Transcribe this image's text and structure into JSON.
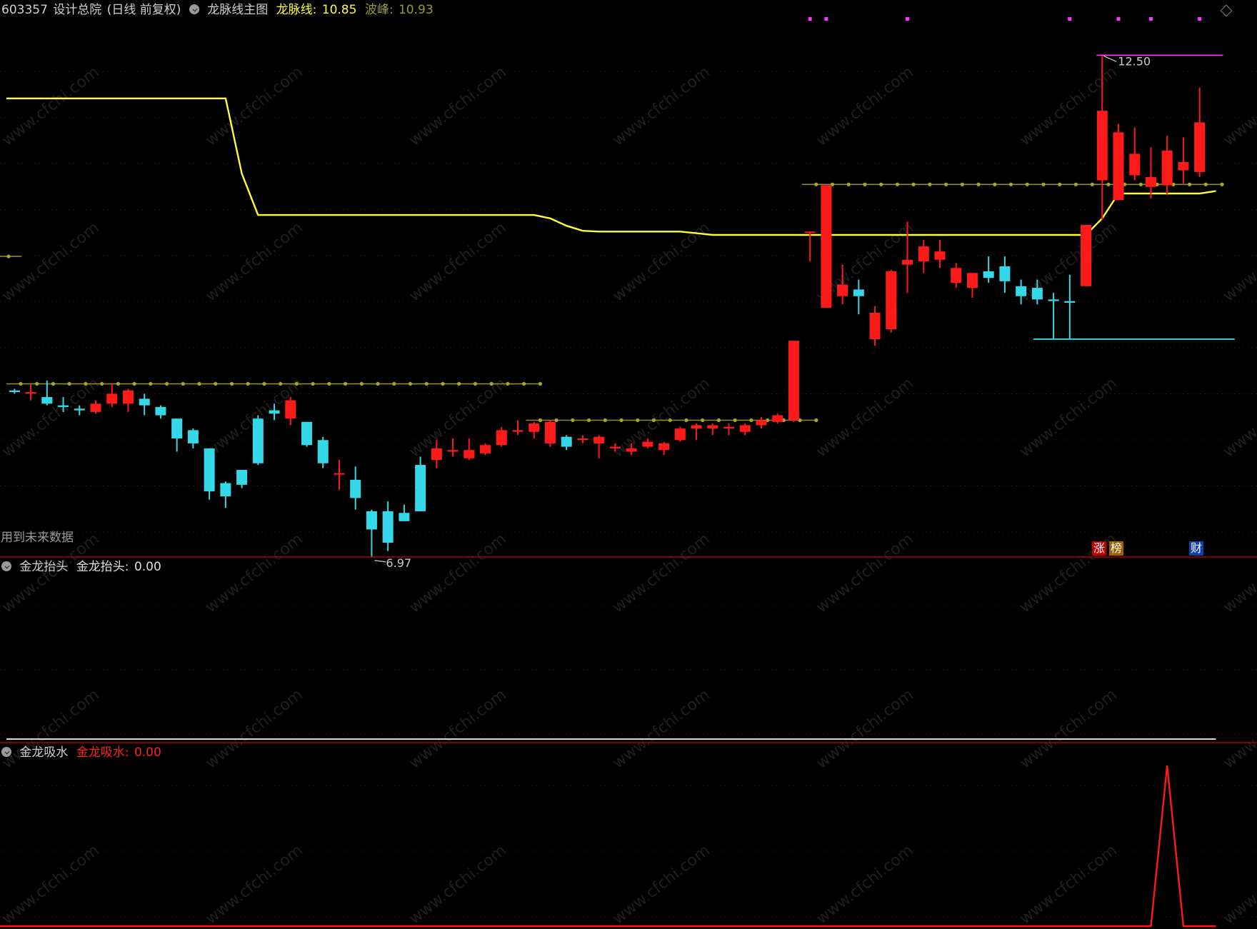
{
  "main_panel": {
    "stock_code": "603357",
    "stock_name": "设计总院",
    "period": "(日线 前复权)",
    "indicator_name": "龙脉线主图",
    "line1_label": "龙脉线:",
    "line1_value": "10.85",
    "line2_label": "波峰:",
    "line2_value": "10.93",
    "high_marker": "12.50",
    "low_marker": "6.97",
    "future_data_note": "用到未来数据",
    "badge_zhang": "涨",
    "badge_bang": "榜",
    "badge_cai": "财"
  },
  "sub_panel_1": {
    "name": "金龙抬头",
    "series_label": "金龙抬头:",
    "value": "0.00"
  },
  "sub_panel_2": {
    "name": "金龙吸水",
    "series_label": "金龙吸水:",
    "value": "0.00"
  },
  "watermark": "www.cfchi.com",
  "colors": {
    "up": "#ff1a1a",
    "down": "#35d8e8",
    "dragon_line": "#ffff33",
    "peak_line": "#8c8c2a",
    "signal_dot": "#ff33ff",
    "divider": "#b00000",
    "grid": "#4a0000"
  },
  "chart_data": [
    {
      "type": "candlestick",
      "title": "龙脉线主图",
      "ylim": [
        6.6,
        12.9
      ],
      "candles": [
        {
          "o": 8.44,
          "h": 8.46,
          "l": 8.4,
          "c": 8.42
        },
        {
          "o": 8.4,
          "h": 8.52,
          "l": 8.32,
          "c": 8.42
        },
        {
          "o": 8.36,
          "h": 8.56,
          "l": 8.26,
          "c": 8.28
        },
        {
          "o": 8.26,
          "h": 8.36,
          "l": 8.18,
          "c": 8.24
        },
        {
          "o": 8.22,
          "h": 8.26,
          "l": 8.14,
          "c": 8.2
        },
        {
          "o": 8.18,
          "h": 8.32,
          "l": 8.16,
          "c": 8.28
        },
        {
          "o": 8.28,
          "h": 8.52,
          "l": 8.24,
          "c": 8.4
        },
        {
          "o": 8.28,
          "h": 8.46,
          "l": 8.18,
          "c": 8.44
        },
        {
          "o": 8.34,
          "h": 8.4,
          "l": 8.14,
          "c": 8.26
        },
        {
          "o": 8.24,
          "h": 8.26,
          "l": 8.1,
          "c": 8.14
        },
        {
          "o": 8.1,
          "h": 8.1,
          "l": 7.7,
          "c": 7.86
        },
        {
          "o": 7.96,
          "h": 7.98,
          "l": 7.74,
          "c": 7.8
        },
        {
          "o": 7.74,
          "h": 7.74,
          "l": 7.12,
          "c": 7.22
        },
        {
          "o": 7.32,
          "h": 7.34,
          "l": 7.02,
          "c": 7.16
        },
        {
          "o": 7.48,
          "h": 7.48,
          "l": 7.26,
          "c": 7.3
        },
        {
          "o": 8.1,
          "h": 8.14,
          "l": 7.54,
          "c": 7.56
        },
        {
          "o": 8.2,
          "h": 8.28,
          "l": 8.08,
          "c": 8.16
        },
        {
          "o": 8.1,
          "h": 8.36,
          "l": 8.02,
          "c": 8.32
        },
        {
          "o": 8.06,
          "h": 8.06,
          "l": 7.76,
          "c": 7.78
        },
        {
          "o": 7.84,
          "h": 7.88,
          "l": 7.5,
          "c": 7.56
        },
        {
          "o": 7.44,
          "h": 7.6,
          "l": 7.24,
          "c": 7.44
        },
        {
          "o": 7.36,
          "h": 7.52,
          "l": 7.0,
          "c": 7.14
        },
        {
          "o": 6.98,
          "h": 7.0,
          "l": 6.42,
          "c": 6.76
        },
        {
          "o": 6.98,
          "h": 7.1,
          "l": 6.5,
          "c": 6.6
        },
        {
          "o": 6.96,
          "h": 7.06,
          "l": 6.86,
          "c": 6.86
        },
        {
          "o": 7.54,
          "h": 7.64,
          "l": 6.98,
          "c": 6.98
        },
        {
          "o": 7.6,
          "h": 7.84,
          "l": 7.5,
          "c": 7.74
        },
        {
          "o": 7.7,
          "h": 7.86,
          "l": 7.64,
          "c": 7.72
        },
        {
          "o": 7.62,
          "h": 7.86,
          "l": 7.6,
          "c": 7.72
        },
        {
          "o": 7.68,
          "h": 7.8,
          "l": 7.66,
          "c": 7.78
        },
        {
          "o": 7.78,
          "h": 8.0,
          "l": 7.76,
          "c": 7.96
        },
        {
          "o": 7.94,
          "h": 8.08,
          "l": 7.9,
          "c": 7.96
        },
        {
          "o": 7.94,
          "h": 8.06,
          "l": 7.86,
          "c": 8.04
        },
        {
          "o": 7.8,
          "h": 8.08,
          "l": 7.76,
          "c": 8.06
        },
        {
          "o": 7.88,
          "h": 7.9,
          "l": 7.72,
          "c": 7.76
        },
        {
          "o": 7.84,
          "h": 7.9,
          "l": 7.8,
          "c": 7.86
        },
        {
          "o": 7.8,
          "h": 7.9,
          "l": 7.62,
          "c": 7.88
        },
        {
          "o": 7.74,
          "h": 7.8,
          "l": 7.7,
          "c": 7.76
        },
        {
          "o": 7.7,
          "h": 7.8,
          "l": 7.66,
          "c": 7.74
        },
        {
          "o": 7.76,
          "h": 7.86,
          "l": 7.74,
          "c": 7.82
        },
        {
          "o": 7.72,
          "h": 7.82,
          "l": 7.66,
          "c": 7.8
        },
        {
          "o": 7.84,
          "h": 8.0,
          "l": 7.82,
          "c": 7.98
        },
        {
          "o": 7.98,
          "h": 8.04,
          "l": 7.84,
          "c": 8.02
        },
        {
          "o": 7.98,
          "h": 8.04,
          "l": 7.9,
          "c": 8.02
        },
        {
          "o": 7.98,
          "h": 8.04,
          "l": 7.9,
          "c": 8.0
        },
        {
          "o": 7.94,
          "h": 8.04,
          "l": 7.9,
          "c": 8.02
        },
        {
          "o": 8.02,
          "h": 8.12,
          "l": 7.98,
          "c": 8.08
        },
        {
          "o": 8.06,
          "h": 8.16,
          "l": 8.04,
          "c": 8.14
        },
        {
          "o": 8.08,
          "h": 9.04,
          "l": 8.06,
          "c": 9.04
        },
        {
          "o": 10.36,
          "h": 10.36,
          "l": 10.0,
          "c": 10.36
        },
        {
          "o": 9.44,
          "h": 10.92,
          "l": 9.44,
          "c": 10.92
        },
        {
          "o": 9.58,
          "h": 9.96,
          "l": 9.48,
          "c": 9.72
        },
        {
          "o": 9.66,
          "h": 9.78,
          "l": 9.36,
          "c": 9.58
        },
        {
          "o": 9.06,
          "h": 9.46,
          "l": 8.98,
          "c": 9.38
        },
        {
          "o": 9.18,
          "h": 9.9,
          "l": 9.14,
          "c": 9.88
        },
        {
          "o": 9.96,
          "h": 10.48,
          "l": 9.62,
          "c": 10.02
        },
        {
          "o": 10.0,
          "h": 10.26,
          "l": 9.86,
          "c": 10.18
        },
        {
          "o": 10.02,
          "h": 10.26,
          "l": 9.92,
          "c": 10.12
        },
        {
          "o": 9.74,
          "h": 9.98,
          "l": 9.68,
          "c": 9.92
        },
        {
          "o": 9.68,
          "h": 9.86,
          "l": 9.56,
          "c": 9.86
        },
        {
          "o": 9.88,
          "h": 10.06,
          "l": 9.74,
          "c": 9.8
        },
        {
          "o": 9.94,
          "h": 10.06,
          "l": 9.62,
          "c": 9.76
        },
        {
          "o": 9.7,
          "h": 9.78,
          "l": 9.48,
          "c": 9.58
        },
        {
          "o": 9.68,
          "h": 9.78,
          "l": 9.48,
          "c": 9.54
        },
        {
          "o": 9.54,
          "h": 9.62,
          "l": 9.06,
          "c": 9.52
        },
        {
          "o": 9.52,
          "h": 9.84,
          "l": 9.06,
          "c": 9.5
        },
        {
          "o": 9.7,
          "h": 10.44,
          "l": 9.7,
          "c": 10.44
        },
        {
          "o": 10.98,
          "h": 12.5,
          "l": 10.5,
          "c": 11.82
        },
        {
          "o": 10.74,
          "h": 11.66,
          "l": 10.74,
          "c": 11.56
        },
        {
          "o": 11.04,
          "h": 11.62,
          "l": 10.98,
          "c": 11.3
        },
        {
          "o": 10.9,
          "h": 11.38,
          "l": 10.76,
          "c": 11.02
        },
        {
          "o": 10.92,
          "h": 11.52,
          "l": 10.8,
          "c": 11.34
        },
        {
          "o": 11.1,
          "h": 11.5,
          "l": 10.94,
          "c": 11.2
        },
        {
          "o": 11.08,
          "h": 12.1,
          "l": 11.02,
          "c": 11.68
        }
      ],
      "dragon_line": [
        11.97,
        11.97,
        11.97,
        11.97,
        11.97,
        11.97,
        11.97,
        11.97,
        11.97,
        11.97,
        11.97,
        11.97,
        11.97,
        11.97,
        11.06,
        10.56,
        10.56,
        10.56,
        10.56,
        10.56,
        10.56,
        10.56,
        10.56,
        10.56,
        10.56,
        10.56,
        10.56,
        10.56,
        10.56,
        10.56,
        10.56,
        10.56,
        10.56,
        10.52,
        10.43,
        10.37,
        10.36,
        10.36,
        10.36,
        10.36,
        10.36,
        10.36,
        10.34,
        10.32,
        10.32,
        10.32,
        10.32,
        10.32,
        10.32,
        10.32,
        10.32,
        10.32,
        10.32,
        10.32,
        10.32,
        10.32,
        10.32,
        10.32,
        10.32,
        10.32,
        10.32,
        10.32,
        10.32,
        10.32,
        10.32,
        10.32,
        10.32,
        10.52,
        10.82,
        10.82,
        10.82,
        10.82,
        10.82,
        10.82,
        10.85
      ],
      "peak_segments": [
        {
          "from": 0,
          "to": 32,
          "value": 8.52
        },
        {
          "from": 32,
          "to": 49,
          "value": 8.08
        },
        {
          "from": 49,
          "to": 74,
          "value": 10.93
        }
      ],
      "support_segment": {
        "from": 63,
        "to": 74,
        "value": 9.06
      },
      "signal_markers": [
        49,
        50,
        55,
        65,
        68,
        70,
        73
      ]
    },
    {
      "type": "line",
      "title": "金龙抬头",
      "values": [
        0,
        0,
        0,
        0,
        0,
        0,
        0,
        0,
        0,
        0,
        0,
        0,
        0,
        0,
        0,
        0,
        0,
        0,
        0,
        0,
        0,
        0,
        0,
        0,
        0,
        0,
        0,
        0,
        0,
        0,
        0,
        0,
        0,
        0,
        0,
        0,
        0,
        0,
        0,
        0,
        0,
        0,
        0,
        0,
        0,
        0,
        0,
        0,
        0,
        0,
        0,
        0,
        0,
        0,
        0,
        0,
        0,
        0,
        0,
        0,
        0,
        0,
        0,
        0,
        0,
        0,
        0,
        0,
        0,
        0,
        0,
        0,
        0,
        0,
        0
      ]
    },
    {
      "type": "line",
      "title": "金龙吸水",
      "values": [
        0,
        0,
        0,
        0,
        0,
        0,
        0,
        0,
        0,
        0,
        0,
        0,
        0,
        0,
        0,
        0,
        0,
        0,
        0,
        0,
        0,
        0,
        0,
        0,
        0,
        0,
        0,
        0,
        0,
        0,
        0,
        0,
        0,
        0,
        0,
        0,
        0,
        0,
        0,
        0,
        0,
        0,
        0,
        0,
        0,
        0,
        0,
        0,
        0,
        0,
        0,
        0,
        0,
        0,
        0,
        0,
        0,
        0,
        0,
        0,
        0,
        0,
        0,
        0,
        0,
        0,
        0,
        0,
        0,
        0,
        0,
        1,
        0,
        0,
        0
      ]
    }
  ]
}
